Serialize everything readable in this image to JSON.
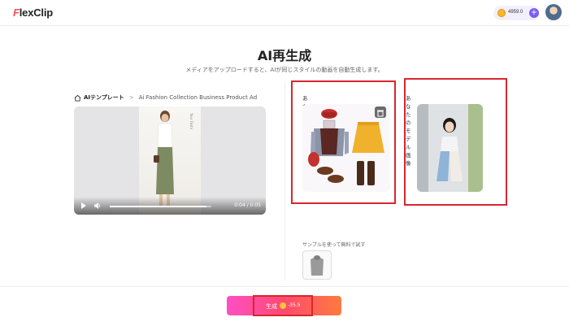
{
  "app": {
    "logo_first": "F",
    "logo_rest": "lexClip"
  },
  "header": {
    "credits": "4959.0",
    "plus_label": "+"
  },
  "page": {
    "title": "AI再生成",
    "subtitle": "メディアをアップロードすると、AIが同じスタイルの動画を自動生成します。"
  },
  "breadcrumb": {
    "root": "AIテンプレート",
    "separator": ">",
    "current": "Ai Fashion Collection Business Product Ad"
  },
  "video": {
    "time": "0:04 / 0:05",
    "progress": 0.95,
    "overlay_text": "Your Fashi"
  },
  "clothes": {
    "label": "あなたの服の画像"
  },
  "model": {
    "label": "あなたのモデル画像"
  },
  "sample": {
    "label": "サンプルを使って無料で試す"
  },
  "generate": {
    "label": "生成",
    "cost": "-35.5"
  },
  "colors": {
    "accent": "#7b5cf5",
    "highlight": "#d8262f",
    "brand_red": "#ff4d5e"
  }
}
